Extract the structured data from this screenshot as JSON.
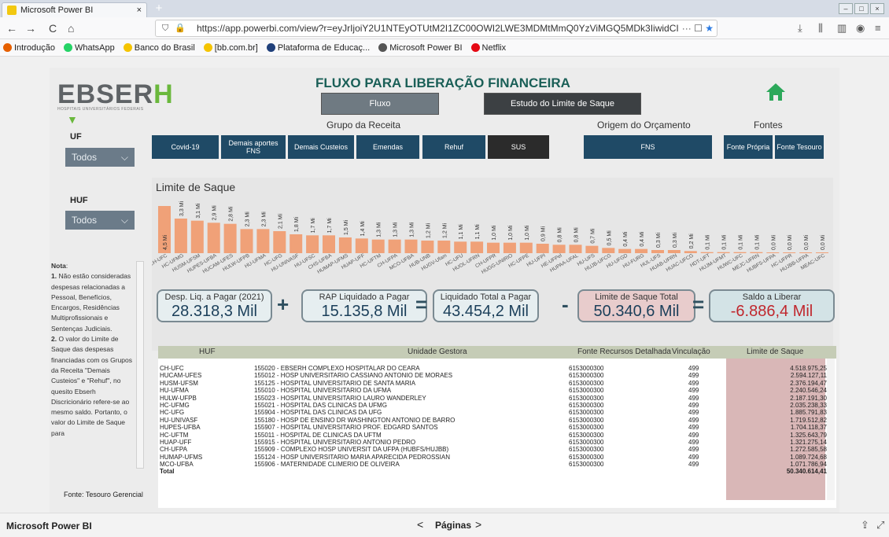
{
  "browser": {
    "tab_title": "Microsoft Power BI",
    "tab_close": "×",
    "new_tab": "+",
    "url": "https://app.powerbi.com/view?r=eyJrIjoiY2U1NTEyOTUtM2I1ZC00OWI2LWE3MDMtMmQ0YzViMGQ5MDk3IiwidCI6IjY",
    "url_more": "···",
    "nav_back": "←",
    "nav_forward": "→",
    "nav_reload": "C",
    "nav_home": "⌂",
    "bookmarks": [
      {
        "label": "Introdução",
        "color": "#e66000"
      },
      {
        "label": "WhatsApp",
        "color": "#25d366"
      },
      {
        "label": "Banco do Brasil",
        "color": "#f5c400"
      },
      {
        "label": "[bb.com.br]",
        "color": "#f5c400"
      },
      {
        "label": "Plataforma de Educaç...",
        "color": "#1f3f7a"
      },
      {
        "label": "Microsoft Power BI",
        "color": "#555555"
      },
      {
        "label": "Netflix",
        "color": "#e50914"
      }
    ]
  },
  "report": {
    "title": "FLUXO PARA LIBERAÇÃO FINANCEIRA",
    "logo_text": "EBSER",
    "logo_accent": "H",
    "logo_sub": "HOSPITAIS UNIVERSITÁRIOS FEDERAIS",
    "nav_fluxo": "Fluxo",
    "nav_estudo": "Estudo do Limite de Saque",
    "uf_label": "UF",
    "uf_value": "Todos",
    "huf_label": "HUF",
    "huf_value": "Todos",
    "grupo_label": "Grupo da Receita",
    "origem_label": "Origem do Orçamento",
    "fontes_label": "Fontes",
    "grupo_buttons": [
      "Covid-19",
      "Demais aportes FNS",
      "Demais Custeios",
      "Emendas",
      "Rehuf",
      "SUS"
    ],
    "origem_button": "FNS",
    "fonte_buttons": [
      "Fonte Própria",
      "Fonte Tesouro"
    ],
    "note": "<b>Nota</b>:<br><b>1.</b> Não estão consideradas despesas relacionadas a Pessoal, Benefícios, Encargos, Residências Multiprofissionais e Sentenças Judiciais.<br><b>2.</b> O valor do Limite de Saque das despesas financiadas com os Grupos da Receita \"Demais Custeios\" e \"Rehuf\", no quesito Ebserh Discricionário refere-se ao mesmo saldo. Portanto, o valor do Limite de Saque para",
    "fonte_note": "Fonte: Tesouro Gerencial"
  },
  "chart_data": {
    "type": "bar",
    "title": "Limite de Saque",
    "bar_color": "#f0a178",
    "categories": [
      "CH-UFC",
      "HC-UFMG",
      "HUSM-UFSM",
      "HUPES-UFBA",
      "HUCAM-UFES",
      "HULW-UFPB",
      "HU-UFMA",
      "HC-UFG",
      "HU-UNIVASF",
      "HU-UFSC",
      "CHS-UFBA",
      "HUMAP-UFMS",
      "HUAP-UFF",
      "HC-UFTM",
      "CH-UFPA",
      "MCO-UFBA",
      "HUB-UNB",
      "HUGV-Ufam",
      "HC-UFU",
      "HUOL-UFRN",
      "CH-UFPR",
      "HUGG-UNIRIO",
      "HC-UFPE",
      "HU-UFPI",
      "HE-UFPel",
      "HUPAA-UFAL",
      "HU-UFS",
      "HUJB-UFCG",
      "HU-UFGD",
      "HU-FURG",
      "HUL-UFS",
      "HUAB-UFRN",
      "HUAC-UFCG",
      "HDT-UFT",
      "HUJM-UFMT",
      "HUWC-UFC",
      "MEJC-UFRN",
      "HUBFS-UFPA",
      "HC-UFPR",
      "HUJBB-UFPA",
      "MEAC-UFC"
    ],
    "labels": [
      "4,5 Mi",
      "3,3 Mi",
      "3,1 Mi",
      "2,9 Mi",
      "2,8 Mi",
      "2,3 Mi",
      "2,3 Mi",
      "2,1 Mi",
      "1,8 Mi",
      "1,7 Mi",
      "1,7 Mi",
      "1,5 Mi",
      "1,4 Mi",
      "1,3 Mi",
      "1,3 Mi",
      "1,3 Mi",
      "1,2 Mi",
      "1,2 Mi",
      "1,1 Mi",
      "1,1 Mi",
      "1,0 Mi",
      "1,0 Mi",
      "1,0 Mi",
      "0,9 Mi",
      "0,8 Mi",
      "0,8 Mi",
      "0,7 Mi",
      "0,5 Mi",
      "0,4 Mi",
      "0,4 Mi",
      "0,3 Mi",
      "0,3 Mi",
      "0,2 Mi",
      "0,1 Mi",
      "0,1 Mi",
      "0,1 Mi",
      "0,1 Mi",
      "0,0 Mi",
      "0,0 Mi",
      "0,0 Mi",
      "0,0 Mi"
    ],
    "values": [
      4.5,
      3.3,
      3.1,
      2.9,
      2.8,
      2.3,
      2.3,
      2.1,
      1.8,
      1.7,
      1.7,
      1.5,
      1.4,
      1.3,
      1.3,
      1.3,
      1.2,
      1.2,
      1.1,
      1.1,
      1.0,
      1.0,
      1.0,
      0.9,
      0.8,
      0.8,
      0.7,
      0.5,
      0.4,
      0.4,
      0.3,
      0.3,
      0.2,
      0.1,
      0.1,
      0.1,
      0.1,
      0.02,
      0.02,
      0.02,
      0.02
    ],
    "ylim": [
      0,
      4.5
    ]
  },
  "metrics": [
    {
      "label": "Desp. Liq. a Pagar (2021)",
      "value": "28.318,3 Mil",
      "color": "#e6eef0"
    },
    {
      "label": "RAP Liquidado a Pagar",
      "value": "15.135,8 Mil",
      "color": "#e6eef0"
    },
    {
      "label": "Liquidado Total a Pagar",
      "value": "43.454,2 Mil",
      "color": "#e6eef0"
    },
    {
      "label": "Limite de Saque Total",
      "value": "50.340,6 Mil",
      "color": "#e8cccc"
    },
    {
      "label": "Saldo a Liberar",
      "value": "-6.886,4 Mil",
      "color": "#d3e3e6",
      "value_color": "#c0272d"
    }
  ],
  "operators": [
    "+",
    "=",
    "-",
    "="
  ],
  "table": {
    "headers": [
      "HUF",
      "Unidade Gestora",
      "Fonte Recursos Detalhada",
      "Vinculação",
      "Limite de Saque"
    ],
    "rows": [
      [
        "CH-UFC",
        "155020 - EBSERH COMPLEXO HOSPITALAR DO CEARA",
        "6153000300",
        "499",
        "4.518.975,25"
      ],
      [
        "HUCAM-UFES",
        "155012 - HOSP UNIVERSITARIO CASSIANO ANTONIO DE MORAES",
        "6153000300",
        "499",
        "2.594.127,11"
      ],
      [
        "HUSM-UFSM",
        "155125 - HOSPITAL UNIVERSITARIO DE SANTA MARIA",
        "6153000300",
        "499",
        "2.376.194,47"
      ],
      [
        "HU-UFMA",
        "155010 - HOSPITAL UNIVERSITARIO DA UFMA",
        "6153000300",
        "499",
        "2.240.546,24"
      ],
      [
        "HULW-UFPB",
        "155023 - HOSPITAL UNIVERSITARIO LAURO WANDERLEY",
        "6153000300",
        "499",
        "2.187.191,30"
      ],
      [
        "HC-UFMG",
        "155021 - HOSPITAL DAS CLINICAS DA UFMG",
        "6153000300",
        "499",
        "2.035.238,33"
      ],
      [
        "HC-UFG",
        "155904 - HOSPITAL DAS CLINICAS DA UFG",
        "6153000300",
        "499",
        "1.885.791,83"
      ],
      [
        "HU-UNIVASF",
        "155180 - HOSP DE ENSINO DR WASHINGTON ANTONIO DE BARRO",
        "6153000300",
        "499",
        "1.719.512,82"
      ],
      [
        "HUPES-UFBA",
        "155907 - HOSPITAL UNIVERSITARIO PROF. EDGARD SANTOS",
        "6153000300",
        "499",
        "1.704.118,37"
      ],
      [
        "HC-UFTM",
        "155011 - HOSPITAL DE CLINICAS DA UFTM",
        "6153000300",
        "499",
        "1.325.643,79"
      ],
      [
        "HUAP-UFF",
        "155915 - HOSPITAL UNIVERSITARIO ANTONIO PEDRO",
        "6153000300",
        "499",
        "1.321.275,14"
      ],
      [
        "CH-UFPA",
        "155909 - COMPLEXO HOSP UNIVERSIT DA UFPA (HUBFS/HUJBB)",
        "6153000300",
        "499",
        "1.272.585,58"
      ],
      [
        "HUMAP-UFMS",
        "155124 - HOSP UNIVERSITARIO MARIA APARECIDA PEDROSSIAN",
        "6153000300",
        "499",
        "1.089.724,68"
      ],
      [
        "MCO-UFBA",
        "155906 - MATERNIDADE CLIMERIO DE OLIVEIRA",
        "6153000300",
        "499",
        "1.071.786,94"
      ]
    ],
    "total_label": "Total",
    "total_value": "50.340.614,41"
  },
  "footer": {
    "app_name": "Microsoft Power BI",
    "pages_label": "Páginas",
    "prev": "<",
    "next": ">"
  }
}
